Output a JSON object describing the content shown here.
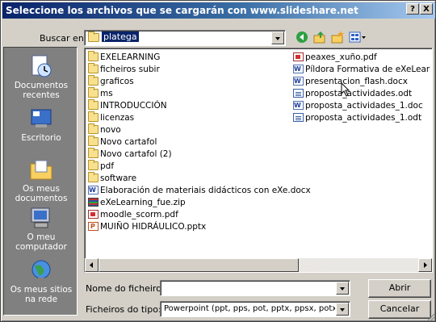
{
  "titlebar": {
    "title": "Seleccione los archivos que se cargarán con www.slideshare.net",
    "help_label": "?",
    "close_label": "X"
  },
  "look_in": {
    "label": "Buscar en:",
    "value": "platega"
  },
  "toolbar": {
    "icons": [
      "back-icon",
      "up-folder-icon",
      "new-folder-icon",
      "view-menu-icon"
    ]
  },
  "places": [
    {
      "label": "Documentos\nrecentes",
      "icon": "recent-documents-icon"
    },
    {
      "label": "Escritorio",
      "icon": "desktop-icon"
    },
    {
      "label": "Os meus\ndocumentos",
      "icon": "my-documents-icon"
    },
    {
      "label": "O meu\ncomputador",
      "icon": "my-computer-icon"
    },
    {
      "label": "Os meus sitios\nna rede",
      "icon": "network-places-icon"
    }
  ],
  "files_col1": [
    {
      "name": "EXELEARNING",
      "type": "folder"
    },
    {
      "name": "ficheiros subir",
      "type": "folder"
    },
    {
      "name": "graficos",
      "type": "folder"
    },
    {
      "name": "ms",
      "type": "folder"
    },
    {
      "name": "INTRODUCCIÓN",
      "type": "folder"
    },
    {
      "name": "licenzas",
      "type": "folder"
    },
    {
      "name": "novo",
      "type": "folder"
    },
    {
      "name": "Novo cartafol",
      "type": "folder"
    },
    {
      "name": "Novo cartafol (2)",
      "type": "folder"
    },
    {
      "name": "pdf",
      "type": "folder"
    },
    {
      "name": "software",
      "type": "folder"
    },
    {
      "name": "Elaboración de materiais didácticos con eXe.docx",
      "type": "doc"
    },
    {
      "name": "eXeLearning_fue.zip",
      "type": "zip"
    },
    {
      "name": "moodle_scorm.pdf",
      "type": "pdf"
    },
    {
      "name": "MUIÑO HIDRÁULICO.pptx",
      "type": "ppt"
    }
  ],
  "files_col2": [
    {
      "name": "peaxes_xuño.pdf",
      "type": "pdf"
    },
    {
      "name": "Píldora Formativa de eXeLearning.d",
      "type": "doc"
    },
    {
      "name": "presentacion_flash.docx",
      "type": "doc"
    },
    {
      "name": "proposta_actividades.odt",
      "type": "odt"
    },
    {
      "name": "proposta_actividades_1.doc",
      "type": "doc"
    },
    {
      "name": "proposta_actividades_1.odt",
      "type": "odt"
    }
  ],
  "filename": {
    "label": "Nome do ficheiro:",
    "value": ""
  },
  "filetype": {
    "label": "Ficheiros do tipo:",
    "value": "Powerpoint (ppt, pps, pot, pptx, ppsx, potx), PD"
  },
  "buttons": {
    "open": "Abrir",
    "cancel": "Cancelar"
  }
}
